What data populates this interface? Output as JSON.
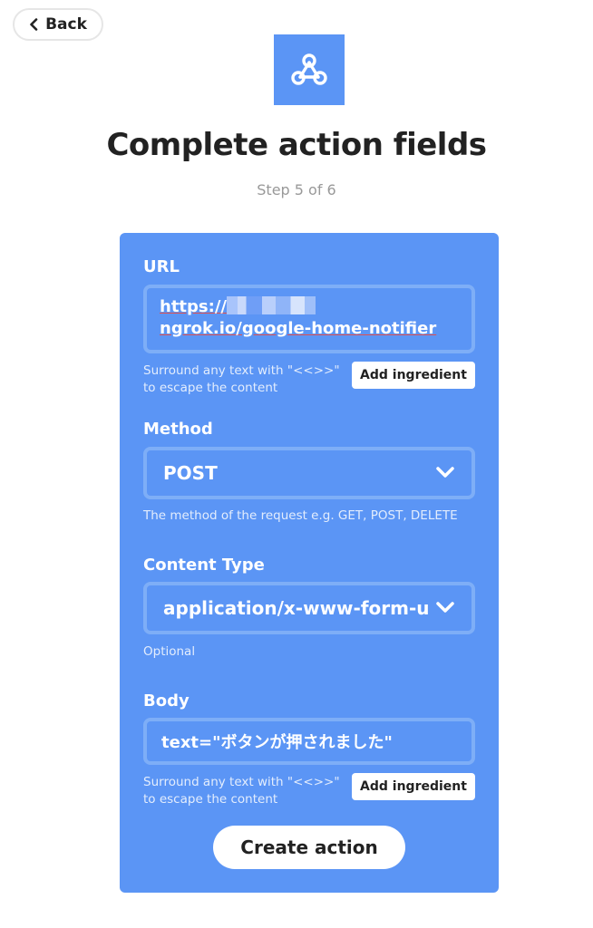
{
  "nav": {
    "back_label": "Back"
  },
  "header": {
    "icon": "webhooks-icon",
    "icon_color": "#5b95f5",
    "title": "Complete action fields",
    "step": "Step 5 of 6"
  },
  "form": {
    "background": "#5b95f5",
    "url": {
      "label": "URL",
      "value_prefix": "https://",
      "value_suffix": "ngrok.io/google-home-notifier",
      "helper_line1": "Surround any text with \"<<>>\"",
      "helper_line2": "to escape the content",
      "add_ingredient_label": "Add ingredient"
    },
    "method": {
      "label": "Method",
      "value": "POST",
      "helper": "The method of the request e.g. GET, POST, DELETE"
    },
    "content_type": {
      "label": "Content Type",
      "value": "application/x-www-form-urlencoded",
      "helper": "Optional"
    },
    "body": {
      "label": "Body",
      "value": "text=\"ボタンが押されました\"",
      "helper_line1": "Surround any text with \"<<>>\"",
      "helper_line2": "to escape the content",
      "add_ingredient_label": "Add ingredient"
    },
    "submit_label": "Create action"
  }
}
